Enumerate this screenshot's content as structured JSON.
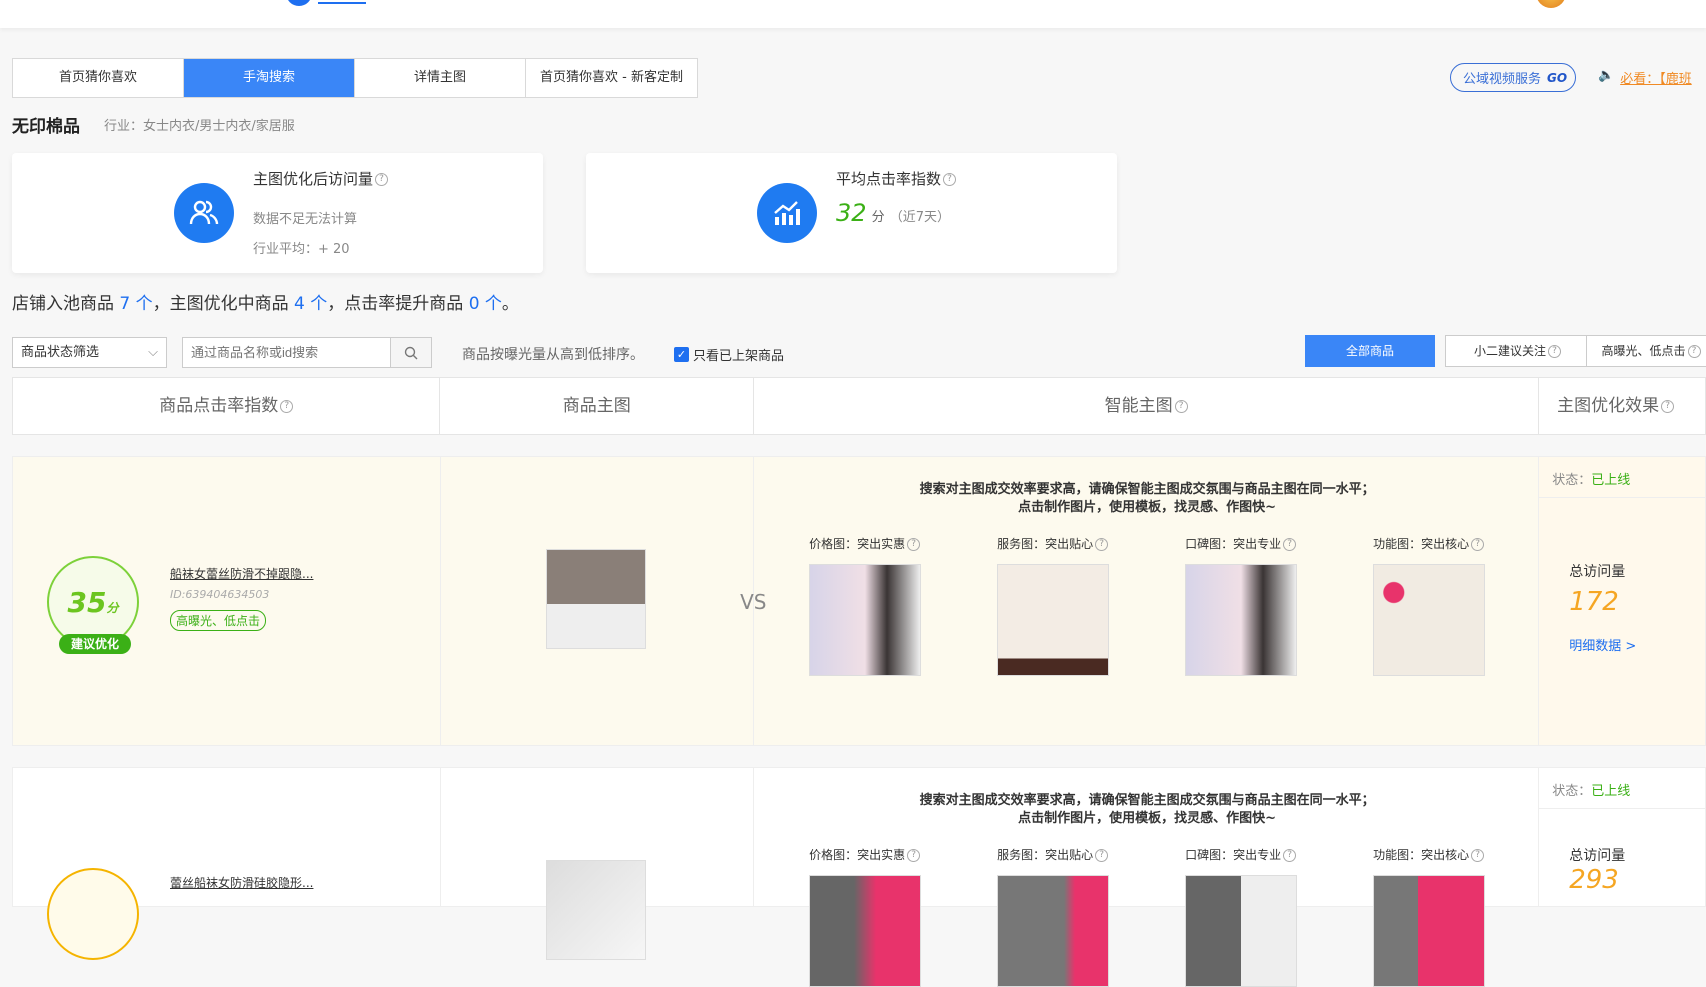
{
  "tabs": [
    {
      "label": "首页猜你喜欢"
    },
    {
      "label": "手淘搜索"
    },
    {
      "label": "详情主图"
    },
    {
      "label": "首页猜你喜欢 - 新客定制"
    }
  ],
  "service_button": {
    "label": "公域视频服务",
    "go": "GO"
  },
  "notice": {
    "text": "必看：【鹿班"
  },
  "shop": {
    "name": "无印棉品",
    "industry": "行业：女士内衣/男士内衣/家居服"
  },
  "cards": [
    {
      "title": "主图优化后访问量",
      "line1": "数据不足无法计算",
      "line2": "行业平均：+ 20"
    },
    {
      "title": "平均点击率指数",
      "score": "32",
      "unit": "分",
      "period": "（近7天）"
    }
  ],
  "stats": {
    "t1": "店铺入池商品 ",
    "n1": "7 个",
    "t2": "，主图优化中商品 ",
    "n2": "4 个",
    "t3": "，点击率提升商品 ",
    "n3": "0 个",
    "t4": "。"
  },
  "filters": {
    "status_select": "商品状态筛选",
    "search_placeholder": "通过商品名称或id搜索",
    "sort_text": "商品按曝光量从高到低排序。",
    "only_listed": "只看已上架商品",
    "btn_all": "全部商品",
    "btn_focus": "小二建议关注",
    "btn_high": "高曝光、低点击"
  },
  "columns": [
    "商品点击率指数",
    "商品主图",
    "智能主图",
    "主图优化效果"
  ],
  "hint": {
    "line1": "搜索对主图成交效率要求高，请确保智能主图成交氛围与商品主图在同一水平；",
    "line2": "点击制作图片，使用模板，找灵感、作图快~"
  },
  "slot_labels": [
    "价格图：突出实惠",
    "服务图：突出贴心",
    "口碑图：突出专业",
    "功能图：突出核心"
  ],
  "vs": "VS",
  "rows": [
    {
      "score": "35",
      "unit": "分",
      "advice": "建议优化",
      "name": "船袜女蕾丝防滑不掉跟隐...",
      "id": "ID:639404634503",
      "tag": "高曝光、低点击",
      "status_label": "状态：",
      "status": "已上线",
      "visits_label": "总访问量",
      "visits": "172",
      "detail": "明细数据 >",
      "score_color": "#6cc520"
    },
    {
      "name": "蕾丝船袜女防滑硅胶隐形...",
      "status_label": "状态：",
      "status": "已上线",
      "visits_label": "总访问量",
      "visits": "293",
      "score_color": "#f5b400"
    }
  ]
}
